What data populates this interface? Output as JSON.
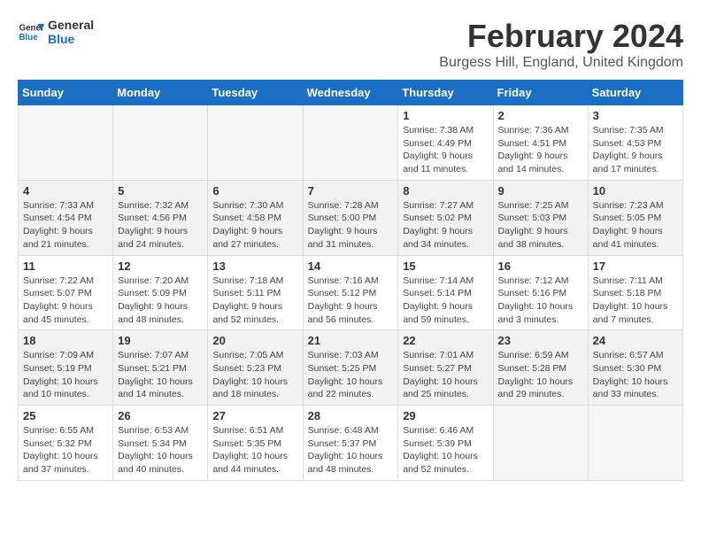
{
  "logo": {
    "line1": "General",
    "line2": "Blue"
  },
  "title": "February 2024",
  "subtitle": "Burgess Hill, England, United Kingdom",
  "days_of_week": [
    "Sunday",
    "Monday",
    "Tuesday",
    "Wednesday",
    "Thursday",
    "Friday",
    "Saturday"
  ],
  "weeks": [
    [
      {
        "day": "",
        "info": ""
      },
      {
        "day": "",
        "info": ""
      },
      {
        "day": "",
        "info": ""
      },
      {
        "day": "",
        "info": ""
      },
      {
        "day": "1",
        "info": "Sunrise: 7:38 AM\nSunset: 4:49 PM\nDaylight: 9 hours and 11 minutes."
      },
      {
        "day": "2",
        "info": "Sunrise: 7:36 AM\nSunset: 4:51 PM\nDaylight: 9 hours and 14 minutes."
      },
      {
        "day": "3",
        "info": "Sunrise: 7:35 AM\nSunset: 4:53 PM\nDaylight: 9 hours and 17 minutes."
      }
    ],
    [
      {
        "day": "4",
        "info": "Sunrise: 7:33 AM\nSunset: 4:54 PM\nDaylight: 9 hours and 21 minutes."
      },
      {
        "day": "5",
        "info": "Sunrise: 7:32 AM\nSunset: 4:56 PM\nDaylight: 9 hours and 24 minutes."
      },
      {
        "day": "6",
        "info": "Sunrise: 7:30 AM\nSunset: 4:58 PM\nDaylight: 9 hours and 27 minutes."
      },
      {
        "day": "7",
        "info": "Sunrise: 7:28 AM\nSunset: 5:00 PM\nDaylight: 9 hours and 31 minutes."
      },
      {
        "day": "8",
        "info": "Sunrise: 7:27 AM\nSunset: 5:02 PM\nDaylight: 9 hours and 34 minutes."
      },
      {
        "day": "9",
        "info": "Sunrise: 7:25 AM\nSunset: 5:03 PM\nDaylight: 9 hours and 38 minutes."
      },
      {
        "day": "10",
        "info": "Sunrise: 7:23 AM\nSunset: 5:05 PM\nDaylight: 9 hours and 41 minutes."
      }
    ],
    [
      {
        "day": "11",
        "info": "Sunrise: 7:22 AM\nSunset: 5:07 PM\nDaylight: 9 hours and 45 minutes."
      },
      {
        "day": "12",
        "info": "Sunrise: 7:20 AM\nSunset: 5:09 PM\nDaylight: 9 hours and 48 minutes."
      },
      {
        "day": "13",
        "info": "Sunrise: 7:18 AM\nSunset: 5:11 PM\nDaylight: 9 hours and 52 minutes."
      },
      {
        "day": "14",
        "info": "Sunrise: 7:16 AM\nSunset: 5:12 PM\nDaylight: 9 hours and 56 minutes."
      },
      {
        "day": "15",
        "info": "Sunrise: 7:14 AM\nSunset: 5:14 PM\nDaylight: 9 hours and 59 minutes."
      },
      {
        "day": "16",
        "info": "Sunrise: 7:12 AM\nSunset: 5:16 PM\nDaylight: 10 hours and 3 minutes."
      },
      {
        "day": "17",
        "info": "Sunrise: 7:11 AM\nSunset: 5:18 PM\nDaylight: 10 hours and 7 minutes."
      }
    ],
    [
      {
        "day": "18",
        "info": "Sunrise: 7:09 AM\nSunset: 5:19 PM\nDaylight: 10 hours and 10 minutes."
      },
      {
        "day": "19",
        "info": "Sunrise: 7:07 AM\nSunset: 5:21 PM\nDaylight: 10 hours and 14 minutes."
      },
      {
        "day": "20",
        "info": "Sunrise: 7:05 AM\nSunset: 5:23 PM\nDaylight: 10 hours and 18 minutes."
      },
      {
        "day": "21",
        "info": "Sunrise: 7:03 AM\nSunset: 5:25 PM\nDaylight: 10 hours and 22 minutes."
      },
      {
        "day": "22",
        "info": "Sunrise: 7:01 AM\nSunset: 5:27 PM\nDaylight: 10 hours and 25 minutes."
      },
      {
        "day": "23",
        "info": "Sunrise: 6:59 AM\nSunset: 5:28 PM\nDaylight: 10 hours and 29 minutes."
      },
      {
        "day": "24",
        "info": "Sunrise: 6:57 AM\nSunset: 5:30 PM\nDaylight: 10 hours and 33 minutes."
      }
    ],
    [
      {
        "day": "25",
        "info": "Sunrise: 6:55 AM\nSunset: 5:32 PM\nDaylight: 10 hours and 37 minutes."
      },
      {
        "day": "26",
        "info": "Sunrise: 6:53 AM\nSunset: 5:34 PM\nDaylight: 10 hours and 40 minutes."
      },
      {
        "day": "27",
        "info": "Sunrise: 6:51 AM\nSunset: 5:35 PM\nDaylight: 10 hours and 44 minutes."
      },
      {
        "day": "28",
        "info": "Sunrise: 6:48 AM\nSunset: 5:37 PM\nDaylight: 10 hours and 48 minutes."
      },
      {
        "day": "29",
        "info": "Sunrise: 6:46 AM\nSunset: 5:39 PM\nDaylight: 10 hours and 52 minutes."
      },
      {
        "day": "",
        "info": ""
      },
      {
        "day": "",
        "info": ""
      }
    ]
  ]
}
